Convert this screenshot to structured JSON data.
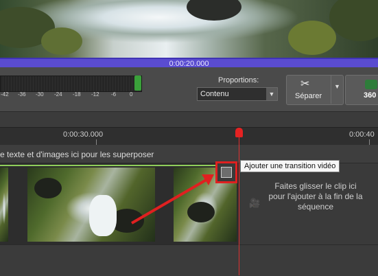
{
  "preview": {
    "timecode": "0:00:20.000"
  },
  "toolbar": {
    "meter_ticks": [
      "-42",
      "-36",
      "-30",
      "-24",
      "-18",
      "-12",
      "-6",
      "0"
    ],
    "proportions_label": "Proportions:",
    "proportions_value": "Contenu",
    "split_label": "Séparer",
    "btn_360_label": "360"
  },
  "timeline": {
    "ruler_labels": [
      "0:00:30.000",
      "0:00:40"
    ],
    "overlay_track_text": "e texte et d'images ici pour les superposer",
    "end_drop_text": "Faites glisser le clip ici pour l'ajouter à la fin de la séquence"
  },
  "transition": {
    "tooltip": "Ajouter une transition vidéo"
  },
  "colors": {
    "accent_timebar": "#5a4cd0",
    "playhead": "#e52222",
    "annotation": "#e02020",
    "clip_marker": "#8fcf5a"
  },
  "icons": [
    "scissors-icon",
    "chevron-down-icon",
    "camera-icon",
    "transition-icon",
    "360-icon"
  ]
}
